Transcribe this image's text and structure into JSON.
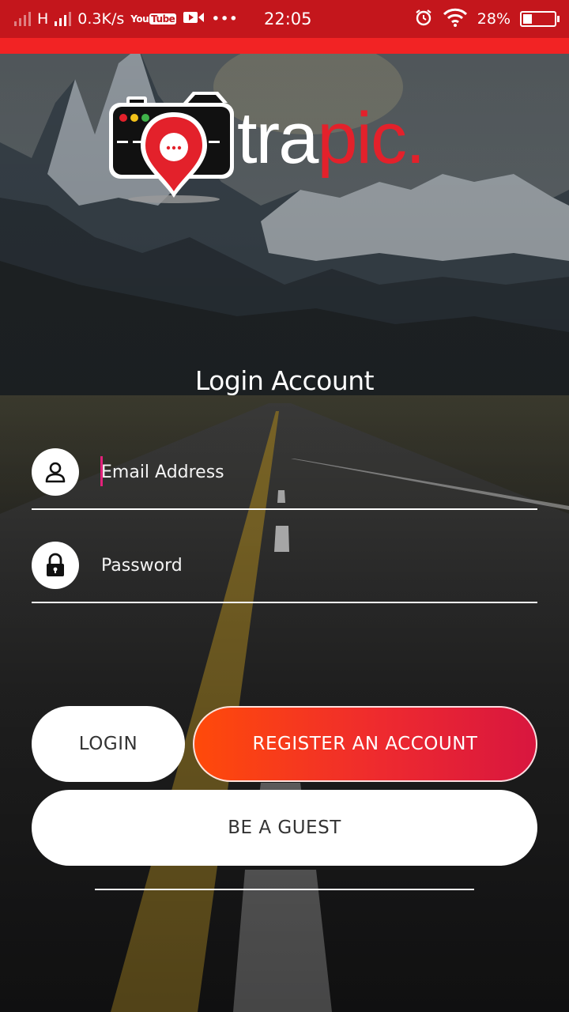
{
  "status_bar": {
    "network_type": "H",
    "speed": "0.3K/s",
    "youtube_a": "You",
    "youtube_b": "Tube",
    "more": "•••",
    "time": "22:05",
    "battery_percent": "28%",
    "battery_level": 0.28
  },
  "logo": {
    "text_part1": "tra",
    "text_part2": "pic."
  },
  "login": {
    "title": "Login Account",
    "email_placeholder": "Email Address",
    "password_placeholder": "Password"
  },
  "buttons": {
    "login": "LOGIN",
    "register": "REGISTER AN ACCOUNT",
    "guest": "BE A GUEST"
  },
  "colors": {
    "status_bar": "#c4161c",
    "strip": "#f22324",
    "brand_red": "#e3212b",
    "gradient_start": "#ff4a0a",
    "gradient_end": "#d8163f"
  }
}
